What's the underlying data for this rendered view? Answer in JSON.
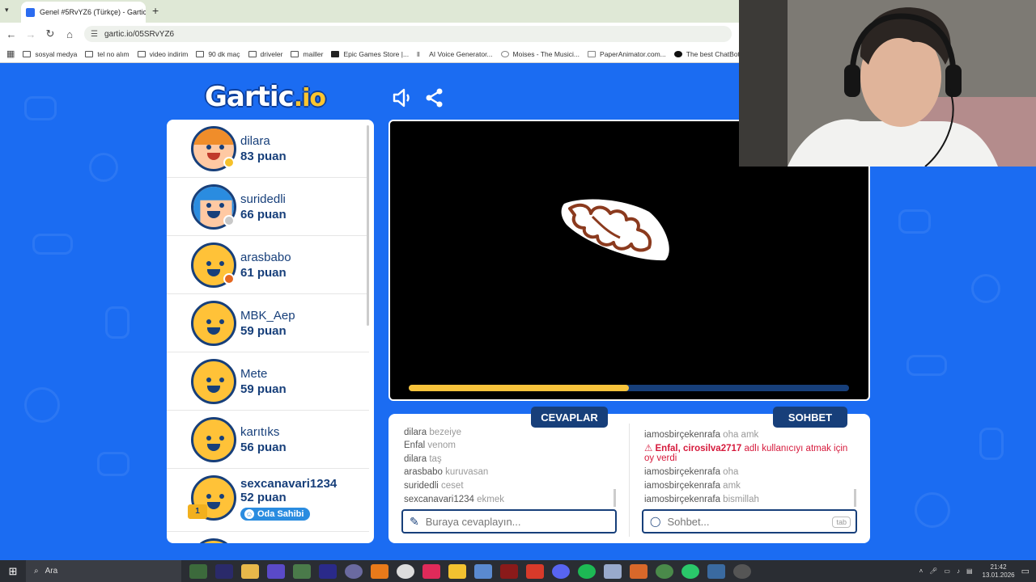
{
  "browser": {
    "tab_title": "Genel #5RvYZ6 (Türkçe) - Gartic",
    "url": "gartic.io/05SRvYZ6",
    "bookmarks": [
      "sosyal medya",
      "tel no alım",
      "video indirim",
      "90 dk maç",
      "driveler",
      "mailler",
      "Epic Games Store |...",
      "AI Voice Generator...",
      "Moises - The Musici...",
      "PaperAnimator.com...",
      "The best ChatBot"
    ]
  },
  "game": {
    "logo_main": "Gartic",
    "logo_suffix": ".io",
    "timer_progress": 0.5
  },
  "players": [
    {
      "name": "dilara",
      "points": "83 puan",
      "status_color": "#f6c12a",
      "avatar": "girl"
    },
    {
      "name": "suridedli",
      "points": "66 puan",
      "status_color": "#c8c8c8",
      "avatar": "blue"
    },
    {
      "name": "arasbabo",
      "points": "61 puan",
      "status_color": "#e5671f",
      "avatar": "default"
    },
    {
      "name": "MBK_Aep",
      "points": "59 puan",
      "avatar": "default"
    },
    {
      "name": "Mete",
      "points": "59 puan",
      "avatar": "default"
    },
    {
      "name": "karıtıks",
      "points": "56 puan",
      "avatar": "default"
    },
    {
      "name": "sexcanavari1234",
      "points": "52 puan",
      "avatar": "default",
      "badge": "Oda Sahibi",
      "crown": "1"
    }
  ],
  "answers": {
    "header": "CEVAPLAR",
    "messages": [
      {
        "user": "dilara",
        "text": "bezeiye"
      },
      {
        "user": "Enfal",
        "text": "venom"
      },
      {
        "user": "dilara",
        "text": "taş"
      },
      {
        "user": "arasbabo",
        "text": "kuruvasan"
      },
      {
        "user": "suridedli",
        "text": "ceset"
      },
      {
        "user": "sexcanavari1234",
        "text": "ekmek"
      }
    ],
    "placeholder": "Buraya cevaplayın..."
  },
  "chat": {
    "header": "SOHBET",
    "messages": [
      {
        "user": "iamosbirçekenrafa",
        "text": "oha amk"
      },
      {
        "alert": true,
        "user": "Enfal, cirosilva2717",
        "text": "adlı kullanıcıyı atmak için oy verdi"
      },
      {
        "user": "iamosbirçekenrafa",
        "text": "oha"
      },
      {
        "user": "iamosbirçekenrafa",
        "text": "amk"
      },
      {
        "user": "iamosbirçekenrafa",
        "text": "bismillah"
      }
    ],
    "placeholder": "Sohbet...",
    "tab_hint": "tab"
  },
  "taskbar": {
    "search_label": "Ara",
    "time": "21:42",
    "date": "13.01.2026"
  }
}
